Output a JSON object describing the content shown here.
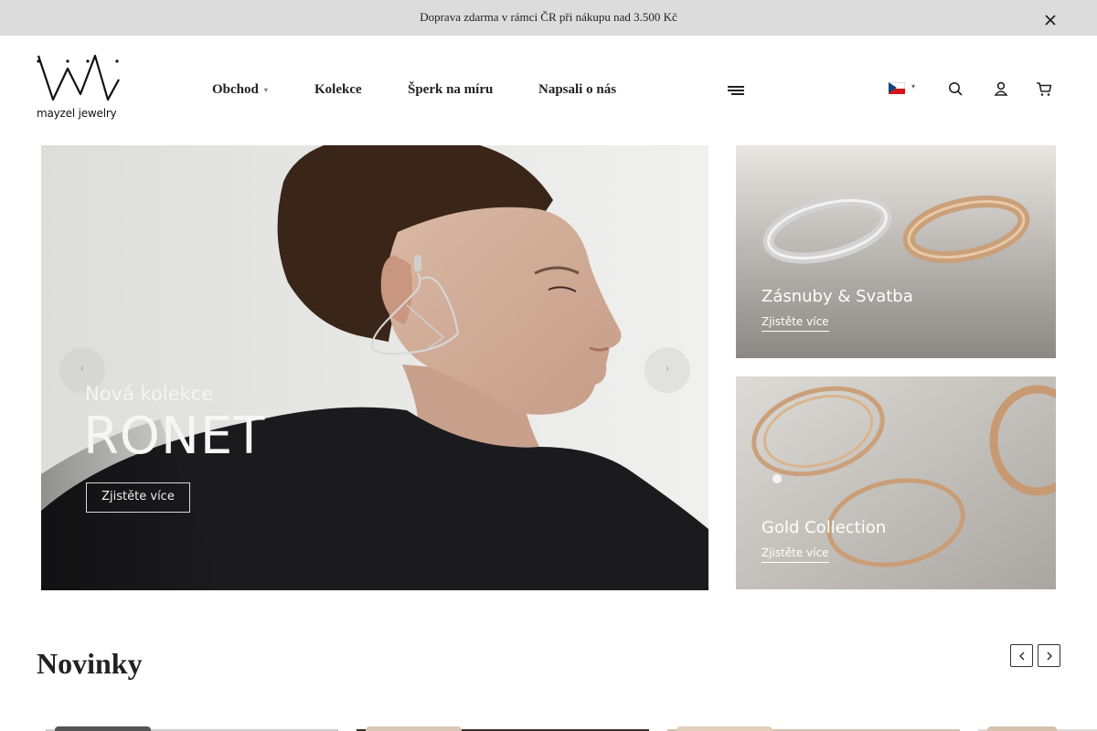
{
  "announcement": {
    "text": "Doprava zdarma v rámci ČR při nákupu nad 3.500 Kč",
    "close_icon": "close-icon"
  },
  "header": {
    "logo_text": "mayzel jewelry",
    "nav": [
      {
        "label": "Obchod",
        "has_dropdown": true
      },
      {
        "label": "Kolekce",
        "has_dropdown": false
      },
      {
        "label": "Šperk na míru",
        "has_dropdown": false
      },
      {
        "label": "Napsali o nás",
        "has_dropdown": false
      }
    ],
    "icons": [
      "menu-icon",
      "flag-cz-icon",
      "search-icon",
      "user-icon",
      "cart-icon"
    ]
  },
  "hero": {
    "subtitle": "Nová kolekce",
    "title": "RONET",
    "button_label": "Zjistěte více",
    "prev_icon": "chevron-left-icon",
    "next_icon": "chevron-right-icon"
  },
  "promo_cards": [
    {
      "title": "Zásnuby & Svatba",
      "link": "Zjistěte více"
    },
    {
      "title": "Gold Collection",
      "link": "Zjistěte více"
    }
  ],
  "novinky": {
    "title": "Novinky",
    "prev_icon": "chevron-left-icon",
    "next_icon": "chevron-right-icon"
  },
  "colors": {
    "announcement_bg": "#dcdcdc",
    "text": "#222222",
    "gold": "#c9a07a",
    "silver": "#c8c8c8"
  }
}
